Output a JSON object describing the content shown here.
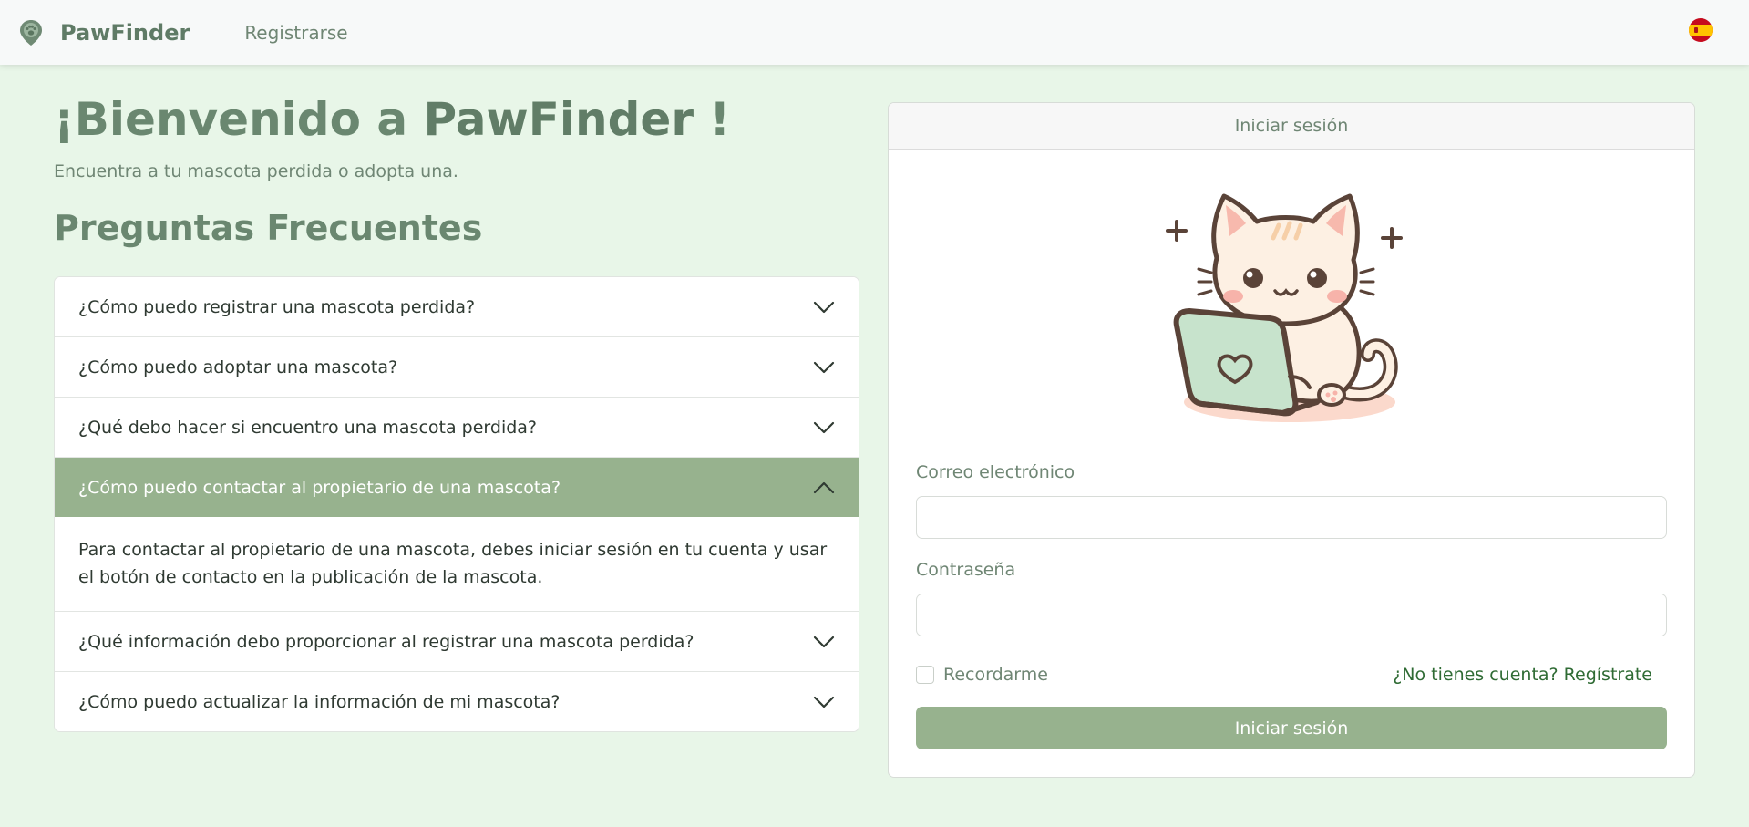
{
  "navbar": {
    "brand_name": "PawFinder",
    "register_link": "Registrarse",
    "language_flag": "spain-flag-icon"
  },
  "hero": {
    "welcome_prefix": "¡Bienvenido a ",
    "welcome_brand": "PawFinder",
    "welcome_suffix": " !",
    "tagline": "Encuentra a tu mascota perdida o adopta una."
  },
  "faq": {
    "title": "Preguntas Frecuentes",
    "items": [
      {
        "question": "¿Cómo puedo registrar una mascota perdida?",
        "expanded": false
      },
      {
        "question": "¿Cómo puedo adoptar una mascota?",
        "expanded": false
      },
      {
        "question": "¿Qué debo hacer si encuentro una mascota perdida?",
        "expanded": false
      },
      {
        "question": "¿Cómo puedo contactar al propietario de una mascota?",
        "expanded": true,
        "answer": "Para contactar al propietario de una mascota, debes iniciar sesión en tu cuenta y usar el botón de contacto en la publicación de la mascota."
      },
      {
        "question": "¿Qué información debo proporcionar al registrar una mascota perdida?",
        "expanded": false
      },
      {
        "question": "¿Cómo puedo actualizar la información de mi mascota?",
        "expanded": false
      }
    ]
  },
  "login": {
    "header": "Iniciar sesión",
    "email_label": "Correo electrónico",
    "email_value": "",
    "password_label": "Contraseña",
    "password_value": "",
    "remember_label": "Recordarme",
    "remember_checked": false,
    "signup_link": "¿No tienes cuenta? Regístrate",
    "submit_label": "Iniciar sesión",
    "illustration": "cat-laptop-illustration"
  },
  "colors": {
    "background": "#e8f6e8",
    "accent": "#97b28e",
    "brand_text": "#5f7b66",
    "link": "#2f6b34"
  }
}
